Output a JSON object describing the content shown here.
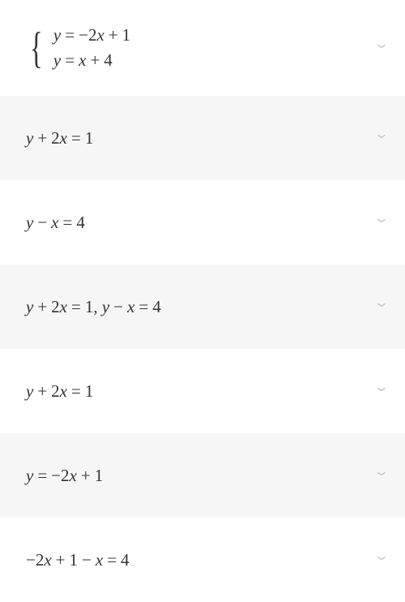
{
  "steps": [
    {
      "type": "system",
      "lines": [
        "y = −2x + 1",
        "y = x + 4"
      ]
    },
    {
      "type": "single",
      "expr": "y + 2x = 1"
    },
    {
      "type": "single",
      "expr": "y − x = 4"
    },
    {
      "type": "single",
      "expr": "y + 2x = 1, y − x = 4"
    },
    {
      "type": "single",
      "expr": "y + 2x = 1"
    },
    {
      "type": "single",
      "expr": "y = −2x + 1"
    },
    {
      "type": "single",
      "expr": "−2x + 1 − x = 4"
    }
  ]
}
